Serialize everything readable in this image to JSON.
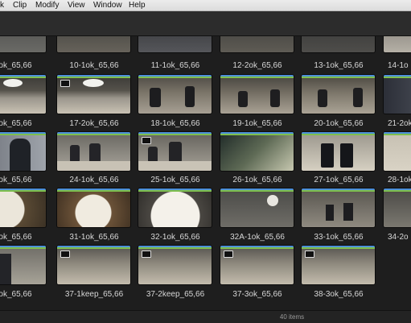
{
  "menu": [
    "k",
    "Clip",
    "Modify",
    "View",
    "Window",
    "Help"
  ],
  "status": "40 items",
  "rows": [
    {
      "labels": [
        "ok_65,66",
        "10-1ok_65,66",
        "11-1ok_65,66",
        "12-2ok_65,66",
        "13-1ok_65,66",
        "14-1o"
      ]
    },
    {
      "labels": [
        "ok_65,66",
        "17-2ok_65,66",
        "18-1ok_65,66",
        "19-1ok_65,66",
        "20-1ok_65,66",
        "21-2ok"
      ]
    },
    {
      "labels": [
        "ok_65,66",
        "24-1ok_65,66",
        "25-1ok_65,66",
        "26-1ok_65,66",
        "27-1ok_65,66",
        "28-1ok"
      ]
    },
    {
      "labels": [
        "ok_65,66",
        "31-1ok_65,66",
        "32-1ok_65,66",
        "32A-1ok_65,66",
        "33-1ok_65,66",
        "34-2o"
      ]
    },
    {
      "labels": [
        "ok_65,66",
        "37-1keep_65,66",
        "37-2keep_65,66",
        "37-3ok_65,66",
        "38-3ok_65,66",
        ""
      ]
    }
  ],
  "colors": {
    "accent_top": "#4c8fd9",
    "accent_bottom": "#7fbf4d"
  }
}
